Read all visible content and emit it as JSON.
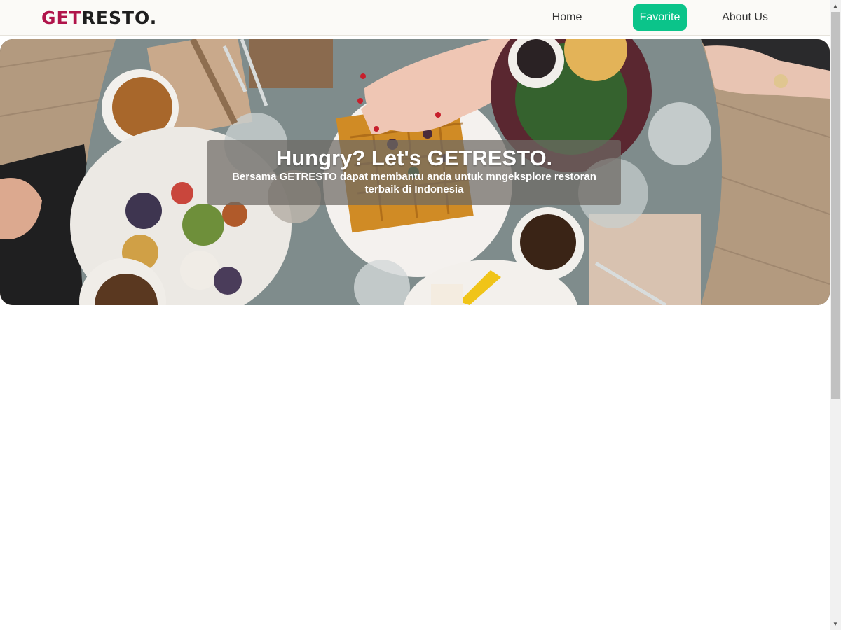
{
  "brand": {
    "accent": "GET",
    "rest": "RESTO.",
    "accent_color": "#b0134a"
  },
  "nav": {
    "home": "Home",
    "favorite": "Favorite",
    "about": "About Us",
    "active_color": "#0bc48a"
  },
  "hero": {
    "title": "Hungry? Let's GETRESTO.",
    "subtitle": "Bersama GETRESTO dapat membantu anda untuk mngeksplore restoran terbaik di Indonesia",
    "image_icon": "restaurant-table-photo"
  },
  "scrollbar": {
    "up_icon": "triangle-up",
    "down_icon": "triangle-down",
    "up_glyph": "▲",
    "down_glyph": "▼"
  }
}
